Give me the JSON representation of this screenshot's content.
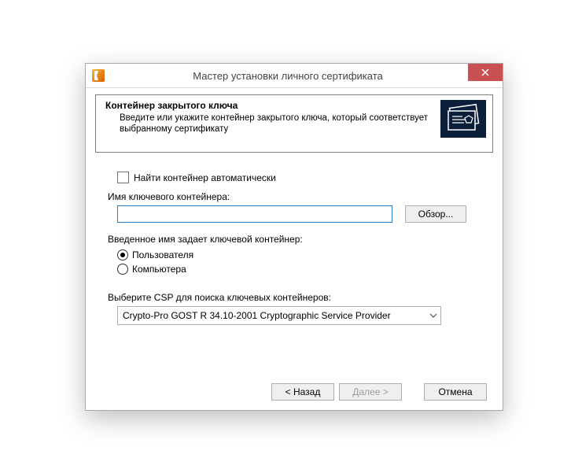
{
  "window": {
    "title": "Мастер установки личного сертификата"
  },
  "header": {
    "title": "Контейнер закрытого ключа",
    "description": "Введите или укажите контейнер закрытого ключа, который соответствует выбранному сертификату"
  },
  "auto_find": {
    "label": "Найти контейнер автоматически",
    "checked": false
  },
  "container_name": {
    "label": "Имя ключевого контейнера:",
    "value": "",
    "browse_button": "Обзор..."
  },
  "scope": {
    "label": "Введенное имя задает ключевой контейнер:",
    "options": {
      "user": "Пользователя",
      "computer": "Компьютера"
    },
    "selected": "user"
  },
  "csp": {
    "label": "Выберите CSP для поиска ключевых контейнеров:",
    "selected": "Crypto-Pro GOST R 34.10-2001 Cryptographic Service Provider"
  },
  "buttons": {
    "back": "< Назад",
    "next": "Далее >",
    "cancel": "Отмена"
  }
}
